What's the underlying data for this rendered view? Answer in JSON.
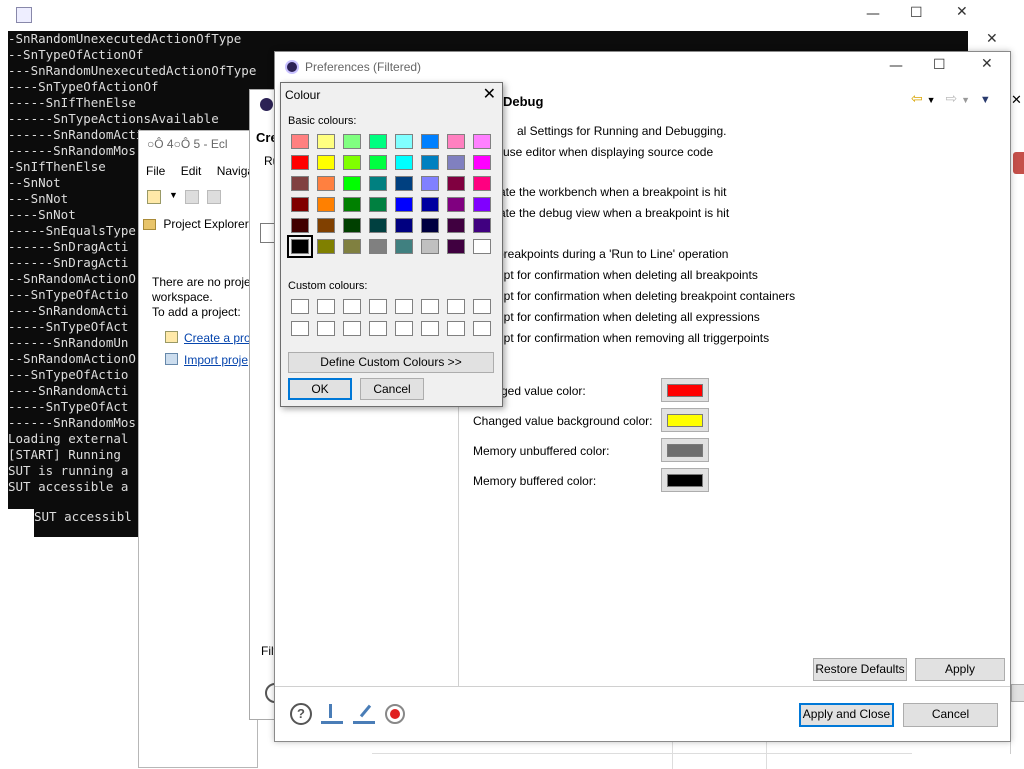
{
  "console": {
    "lines": [
      "-SnRandomUnexecutedActionOfType",
      "--SnTypeOfActionOf",
      "---SnRandomUnexecutedActionOfType",
      "----SnTypeOfActionOf",
      "-----SnIfThenElse",
      "------SnTypeActionsAvailable",
      "------SnRandomActi",
      "------SnRandomMos",
      "-SnIfThenElse",
      "--SnNot",
      "---SnNot",
      "----SnNot",
      "-----SnEqualsType",
      "------SnDragActi",
      "------SnDragActi",
      "--SnRandomActionO",
      "---SnTypeOfActio",
      "----SnRandomActi",
      "-----SnTypeOfAct",
      "------SnRandomUn",
      "--SnRandomActionO",
      "---SnTypeOfActio",
      "----SnRandomActi",
      "-----SnTypeOfAct",
      "------SnRandomMos",
      "Loading external",
      "[START] Running",
      "SUT is running a",
      "SUT accessible a"
    ],
    "sub_line": "SUT accessibl"
  },
  "eclipse": {
    "title": "○Ô 4○Ô 5 - Ecl",
    "menu": [
      "File",
      "Edit",
      "Navigat"
    ],
    "project_explorer_tab": "Project Explorer",
    "message_1": "There are no projec",
    "message_2": "workspace.",
    "message_3": "To add a project:",
    "link_create": "Create a proj",
    "link_import": "Import proje"
  },
  "create_dialog": {
    "title": "Cre",
    "sub": "Ru",
    "filter_label": "Filt"
  },
  "preferences": {
    "title": "Preferences (Filtered)",
    "page_title": "Debug",
    "lines": [
      "al Settings for Running and Debugging.",
      "use editor when displaying source code",
      "tivate the workbench when a breakpoint is hit",
      "tivate the debug view when a breakpoint is hit",
      "p breakpoints during a 'Run to Line' operation",
      "ompt for confirmation when deleting all breakpoints",
      "ompt for confirmation when deleting breakpoint containers",
      "ompt for confirmation when deleting all expressions",
      "ompt for confirmation when removing all triggerpoints"
    ],
    "color_rows": [
      {
        "label": "ged value color:",
        "color": "#ff0000"
      },
      {
        "label": "Changed value background color:",
        "color": "#ffff00"
      },
      {
        "label": "Memory unbuffered color:",
        "color": "#6e6e6e"
      },
      {
        "label": "Memory buffered color:",
        "color": "#000000"
      }
    ],
    "restore_defaults": "Restore Defaults",
    "apply": "Apply",
    "apply_close": "Apply and Close",
    "cancel": "Cancel"
  },
  "colour_dialog": {
    "title": "Colour",
    "basic_label": "Basic colours:",
    "custom_label": "Custom colours:",
    "define_custom": "Define Custom Colours >>",
    "ok": "OK",
    "cancel": "Cancel",
    "basic_colours": [
      [
        "#ff8080",
        "#ffff80",
        "#80ff80",
        "#00ff80",
        "#80ffff",
        "#0080ff",
        "#ff80c0",
        "#ff80ff"
      ],
      [
        "#ff0000",
        "#ffff00",
        "#80ff00",
        "#00ff40",
        "#00ffff",
        "#0080c0",
        "#8080c0",
        "#ff00ff"
      ],
      [
        "#804040",
        "#ff8040",
        "#00ff00",
        "#008080",
        "#004080",
        "#8080ff",
        "#800040",
        "#ff0080"
      ],
      [
        "#800000",
        "#ff8000",
        "#008000",
        "#008040",
        "#0000ff",
        "#0000a0",
        "#800080",
        "#8000ff"
      ],
      [
        "#400000",
        "#804000",
        "#004000",
        "#004040",
        "#000080",
        "#000040",
        "#400040",
        "#400080"
      ],
      [
        "#000000",
        "#808000",
        "#808040",
        "#808080",
        "#408080",
        "#c0c0c0",
        "#400040",
        "#ffffff"
      ]
    ],
    "selected": [
      5,
      0
    ]
  }
}
